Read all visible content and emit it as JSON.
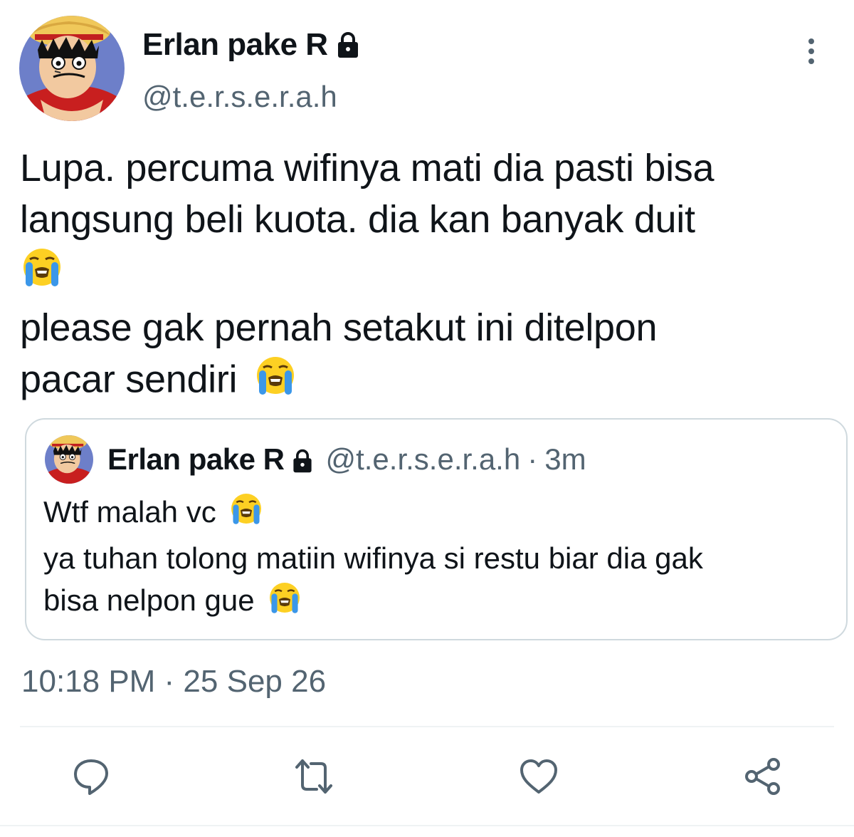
{
  "author": {
    "display_name": "Erlan pake R",
    "handle": "@t.e.r.s.e.r.a.h",
    "protected": true
  },
  "tweet": {
    "lines": [
      "Lupa. percuma wifinya mati dia pasti bisa",
      "langsung beli kuota. dia kan banyak duit",
      "please gak pernah setakut ini ditelpon",
      "pacar sendiri"
    ],
    "emoji": "loudly-crying-face"
  },
  "quoted_tweet": {
    "display_name": "Erlan pake R",
    "handle": "@t.e.r.s.e.r.a.h",
    "separator": "·",
    "time": "3m",
    "lines": [
      "Wtf malah vc",
      "ya tuhan tolong matiin wifinya si restu biar dia gak",
      "bisa nelpon gue"
    ]
  },
  "timestamp": "10:18 PM · 25 Sep 26",
  "actions": [
    "reply-icon",
    "retweet-icon",
    "like-icon",
    "share-icon"
  ],
  "colors": {
    "text": "#0f1419",
    "secondary": "#536471",
    "border": "#cfd9de",
    "divider": "#eff3f4",
    "emoji_face": "#fdd023",
    "emoji_tears": "#3b97e9"
  }
}
